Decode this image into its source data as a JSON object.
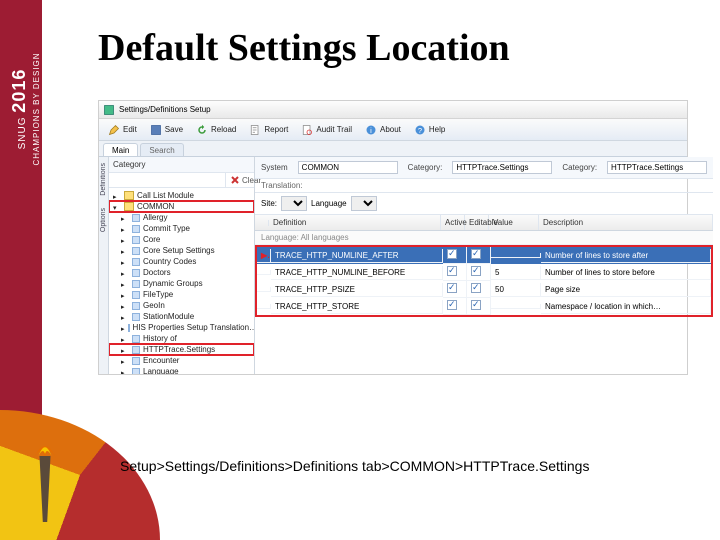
{
  "brand": {
    "name": "SNUG",
    "year": "2016",
    "tag": "CHAMPIONS BY DESIGN"
  },
  "slide": {
    "title": "Default Settings Location",
    "caption": "Setup>Settings/Definitions>Definitions tab>COMMON>HTTPTrace.Settings"
  },
  "app": {
    "title": "Settings/Definitions Setup",
    "toolbar": [
      {
        "key": "edit",
        "label": "Edit"
      },
      {
        "key": "save",
        "label": "Save"
      },
      {
        "key": "reload",
        "label": "Reload"
      },
      {
        "key": "report",
        "label": "Report"
      },
      {
        "key": "audit",
        "label": "Audit Trail"
      },
      {
        "key": "about",
        "label": "About"
      },
      {
        "key": "help",
        "label": "Help"
      }
    ],
    "tabs": {
      "main": "Main",
      "secondary": "Search"
    },
    "vtabs": [
      "Definitions",
      "Options"
    ],
    "tree": {
      "head": "Category",
      "search_placeholder": "",
      "clear": "Clear",
      "nodes": [
        {
          "lvl": 1,
          "expand": "col",
          "type": "folder",
          "label": "Call List Module"
        },
        {
          "lvl": 1,
          "expand": "exp",
          "type": "folder",
          "label": "COMMON",
          "hl": true
        },
        {
          "lvl": 2,
          "expand": "col",
          "type": "leaf",
          "label": "Allergy"
        },
        {
          "lvl": 2,
          "expand": "col",
          "type": "leaf",
          "label": "Commit Type"
        },
        {
          "lvl": 2,
          "expand": "col",
          "type": "leaf",
          "label": "Core"
        },
        {
          "lvl": 2,
          "expand": "col",
          "type": "leaf",
          "label": "Core Setup Settings"
        },
        {
          "lvl": 2,
          "expand": "col",
          "type": "leaf",
          "label": "Country Codes"
        },
        {
          "lvl": 2,
          "expand": "col",
          "type": "leaf",
          "label": "Doctors"
        },
        {
          "lvl": 2,
          "expand": "col",
          "type": "leaf",
          "label": "Dynamic Groups"
        },
        {
          "lvl": 2,
          "expand": "col",
          "type": "leaf",
          "label": "FileType"
        },
        {
          "lvl": 2,
          "expand": "col",
          "type": "leaf",
          "label": "GeoIn"
        },
        {
          "lvl": 2,
          "expand": "col",
          "type": "leaf",
          "label": "StationModule"
        },
        {
          "lvl": 2,
          "expand": "col",
          "type": "leaf",
          "label": "HIS Properties Setup Translation…"
        },
        {
          "lvl": 2,
          "expand": "col",
          "type": "leaf",
          "label": "History of"
        },
        {
          "lvl": 2,
          "expand": "col",
          "type": "leaf",
          "label": "HTTPTrace.Settings",
          "hl": true
        },
        {
          "lvl": 2,
          "expand": "col",
          "type": "leaf",
          "label": "Encounter"
        },
        {
          "lvl": 2,
          "expand": "col",
          "type": "leaf",
          "label": "Language"
        }
      ]
    },
    "filters": {
      "system_label": "System",
      "system_value": "COMMON",
      "category_label": "Category:",
      "category_value": "HTTPTrace.Settings",
      "category2_label": "Category:",
      "category2_value": "HTTPTrace.Settings"
    },
    "subhead": "Translation:",
    "gridfilter": {
      "site_label": "Site:",
      "site_value": "",
      "lang_label": "Language",
      "lang_value": ""
    },
    "grid": {
      "columns": [
        "",
        "Definition",
        "Active",
        "Editable",
        "Value",
        "Description"
      ],
      "lang_banner": "Language: All languages",
      "rows": [
        {
          "def": "TRACE_HTTP_NUMLINE_AFTER",
          "active": true,
          "editable": true,
          "value": "",
          "desc": "Number of lines to store after",
          "sel": true
        },
        {
          "def": "TRACE_HTTP_NUMLINE_BEFORE",
          "active": true,
          "editable": true,
          "value": "5",
          "desc": "Number of lines to store before"
        },
        {
          "def": "TRACE_HTTP_PSIZE",
          "active": true,
          "editable": true,
          "value": "50",
          "desc": "Page size"
        },
        {
          "def": "TRACE_HTTP_STORE",
          "active": true,
          "editable": true,
          "value": "",
          "desc": "Namespace / location in which…"
        }
      ]
    }
  }
}
